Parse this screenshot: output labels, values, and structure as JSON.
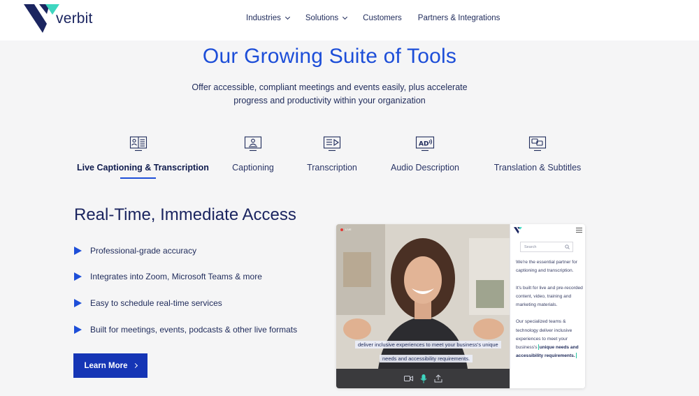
{
  "header": {
    "logo_text": "verbit",
    "nav": [
      {
        "label": "Industries",
        "has_dropdown": true
      },
      {
        "label": "Solutions",
        "has_dropdown": true
      },
      {
        "label": "Customers",
        "has_dropdown": false
      },
      {
        "label": "Partners & Integrations",
        "has_dropdown": false
      }
    ]
  },
  "hero": {
    "title": "Our Growing Suite of Tools",
    "subtitle_line1": "Offer accessible, compliant meetings and events easily, plus accelerate",
    "subtitle_line2": "progress and productivity within your organization"
  },
  "tabs": [
    {
      "label": "Live Captioning & Transcription",
      "icon": "live-captioning-icon",
      "active": true
    },
    {
      "label": "Captioning",
      "icon": "captioning-icon",
      "active": false
    },
    {
      "label": "Transcription",
      "icon": "transcription-icon",
      "active": false
    },
    {
      "label": "Audio Description",
      "icon": "audio-description-icon",
      "active": false
    },
    {
      "label": "Translation & Subtitles",
      "icon": "translation-icon",
      "active": false
    }
  ],
  "content": {
    "title": "Real-Time, Immediate Access",
    "features": [
      "Professional-grade accuracy",
      "Integrates into Zoom, Microsoft Teams & more",
      "Easy to schedule real-time services",
      "Built for meetings, events, podcasts & other live formats"
    ],
    "cta_label": "Learn More"
  },
  "video": {
    "live_label": "LIVE",
    "caption_line1": "deliver inclusive experiences to meet your business's unique",
    "caption_line2": "needs and accessibility requirements."
  },
  "side_panel": {
    "search_placeholder": "Search",
    "para1": "We're the essential partner for captioning and transcription.",
    "para2": "It's built for live and pre-recorded content, video, training and marketing materials.",
    "para3_start": "Our specialized teams & technology deliver inclusive experiences to meet your business's",
    "para3_bold": "unique needs and accessibility requirements."
  },
  "colors": {
    "brand_blue": "#1d4ed8",
    "navy": "#1b2560",
    "button": "#1535b5",
    "teal": "#25c4a0",
    "background": "#f5f5f6"
  }
}
